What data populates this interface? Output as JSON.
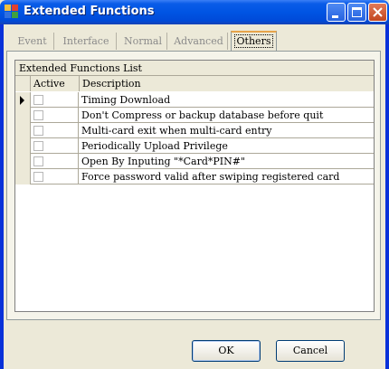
{
  "window": {
    "title": "Extended Functions",
    "icons": {
      "app": "app-window-icon",
      "minimize": "minimize-icon",
      "maximize": "maximize-icon",
      "close": "close-icon"
    }
  },
  "tabs": [
    {
      "label": "Event",
      "active": false
    },
    {
      "label": "Interface",
      "active": false
    },
    {
      "label": "Normal",
      "active": false
    },
    {
      "label": "Advanced",
      "active": false
    },
    {
      "label": "Others",
      "active": true
    }
  ],
  "grid": {
    "caption": "Extended Functions List",
    "columns": {
      "active": "Active",
      "description": "Description"
    },
    "rows": [
      {
        "active": false,
        "description": "Timing Download",
        "current": true
      },
      {
        "active": false,
        "description": "Don't Compress or backup database before quit",
        "current": false
      },
      {
        "active": false,
        "description": "Multi-card exit when multi-card entry",
        "current": false
      },
      {
        "active": false,
        "description": "Periodically Upload Privilege",
        "current": false
      },
      {
        "active": false,
        "description": "Open By Inputing \"*Card*PIN#\"",
        "current": false
      },
      {
        "active": false,
        "description": "Force password valid after swiping registered card",
        "current": false
      }
    ]
  },
  "buttons": {
    "ok": "OK",
    "cancel": "Cancel"
  },
  "colors": {
    "titlebar": "#0054e3",
    "face": "#ece9d8",
    "active_tab_accent": "#e7a44b"
  }
}
